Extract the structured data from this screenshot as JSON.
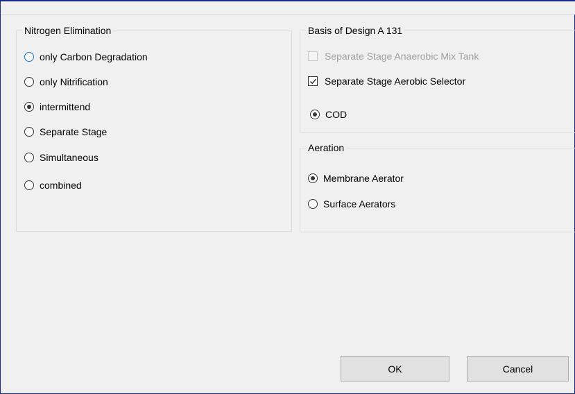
{
  "nitrogen_group": {
    "title": "Nitrogen Elimination",
    "options": [
      {
        "label": "only Carbon Degradation",
        "selected": false
      },
      {
        "label": "only Nitrification",
        "selected": false
      },
      {
        "label": "intermittend",
        "selected": true
      },
      {
        "label": "Separate Stage",
        "selected": false
      },
      {
        "label": "Simultaneous",
        "selected": false
      },
      {
        "label": "combined",
        "selected": false
      }
    ]
  },
  "basis_group": {
    "title": "Basis of Design A 131",
    "anaerobic_label": "Separate Stage Anaerobic Mix Tank",
    "anaerobic_checked": false,
    "anaerobic_enabled": false,
    "aerobic_label": "Separate Stage Aerobic Selector",
    "aerobic_checked": true,
    "cod_label": "COD",
    "cod_selected": true
  },
  "aeration_group": {
    "title": "Aeration",
    "options": [
      {
        "label": "Membrane Aerator",
        "selected": true
      },
      {
        "label": "Surface Aerators",
        "selected": false
      }
    ]
  },
  "buttons": {
    "ok": "OK",
    "cancel": "Cancel"
  }
}
